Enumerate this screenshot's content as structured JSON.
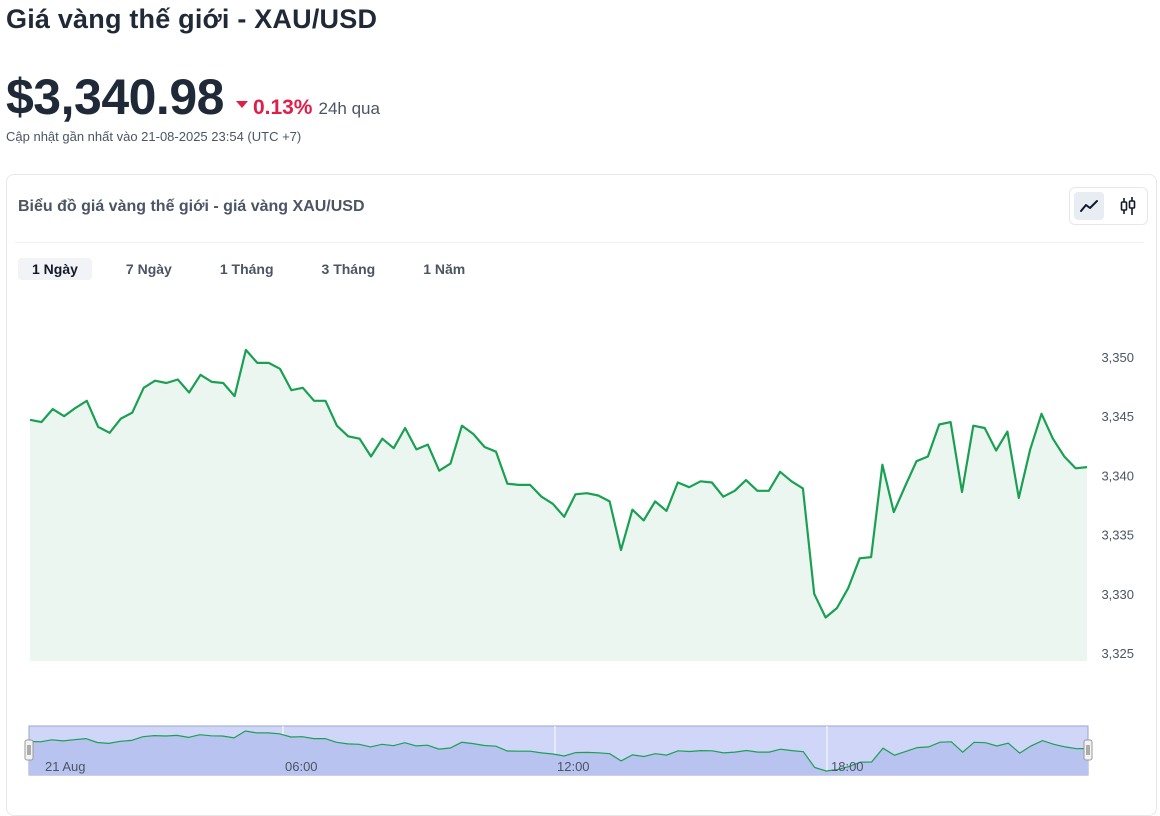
{
  "header": {
    "title": "Giá vàng thế giới - XAU/USD",
    "price": "$3,340.98",
    "change_pct": "0.13%",
    "change_period": "24h qua",
    "updated": "Cập nhật gần nhất vào 21-08-2025 23:54 (UTC +7)",
    "change_color": "#e11d48"
  },
  "card": {
    "title": "Biểu đồ giá vàng thế giới - giá vàng XAU/USD",
    "toggles": [
      {
        "name": "line-chart-icon",
        "active": true
      },
      {
        "name": "candlestick-icon",
        "active": false
      }
    ]
  },
  "tabs": [
    {
      "label": "1 Ngày",
      "active": true
    },
    {
      "label": "7 Ngày",
      "active": false
    },
    {
      "label": "1 Tháng",
      "active": false
    },
    {
      "label": "3 Tháng",
      "active": false
    },
    {
      "label": "1 Năm",
      "active": false
    }
  ],
  "chart_data": {
    "type": "area",
    "line_color": "#1aa053",
    "fill_color": "#ecf6f0",
    "ylim": [
      3324.3,
      3355.5
    ],
    "yticks": [
      3325,
      3330,
      3335,
      3340,
      3345,
      3350
    ],
    "ytick_labels": [
      "3,325",
      "3,330",
      "3,335",
      "3,340",
      "3,345",
      "3,350"
    ],
    "values": [
      3344.7,
      3344.5,
      3345.6,
      3345.0,
      3345.7,
      3346.3,
      3344.1,
      3343.6,
      3344.8,
      3345.3,
      3347.4,
      3348.0,
      3347.8,
      3348.1,
      3347.0,
      3348.5,
      3347.9,
      3347.8,
      3346.7,
      3350.6,
      3349.5,
      3349.5,
      3349.0,
      3347.2,
      3347.4,
      3346.3,
      3346.3,
      3344.2,
      3343.3,
      3343.1,
      3341.6,
      3343.1,
      3342.3,
      3344.0,
      3342.2,
      3342.6,
      3340.4,
      3341.0,
      3344.2,
      3343.5,
      3342.4,
      3342.0,
      3339.3,
      3339.2,
      3339.2,
      3338.2,
      3337.6,
      3336.5,
      3338.4,
      3338.5,
      3338.3,
      3337.8,
      3333.7,
      3337.1,
      3336.2,
      3337.8,
      3337.0,
      3339.4,
      3339.0,
      3339.5,
      3339.4,
      3338.2,
      3338.7,
      3339.6,
      3338.7,
      3338.7,
      3340.3,
      3339.5,
      3338.9,
      3330.0,
      3328.0,
      3328.8,
      3330.5,
      3333.0,
      3333.1,
      3340.9,
      3336.9,
      3339.1,
      3341.2,
      3341.6,
      3344.3,
      3344.5,
      3338.6,
      3344.2,
      3344.0,
      3342.1,
      3343.7,
      3338.1,
      3342.2,
      3345.2,
      3343.1,
      3341.6,
      3340.6,
      3340.7
    ],
    "nav_labels": [
      "21 Aug",
      "06:00",
      "12:00",
      "18:00"
    ]
  }
}
